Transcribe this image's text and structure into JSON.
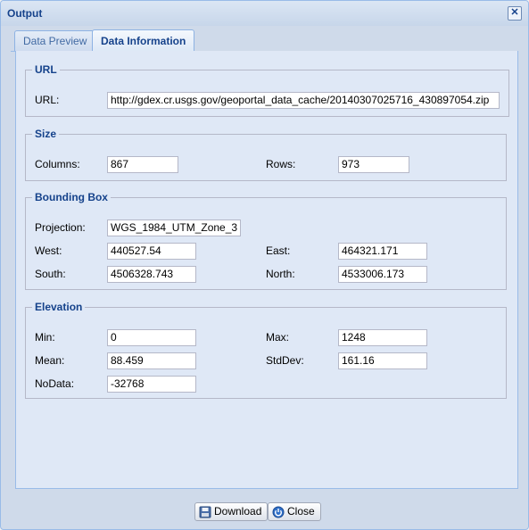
{
  "window": {
    "title": "Output"
  },
  "tabs": [
    {
      "label": "Data Preview"
    },
    {
      "label": "Data Information"
    }
  ],
  "url_section": {
    "legend": "URL",
    "label": "URL:",
    "value": "http://gdex.cr.usgs.gov/geoportal_data_cache/20140307025716_430897054.zip"
  },
  "size_section": {
    "legend": "Size",
    "columns_label": "Columns:",
    "columns": "867",
    "rows_label": "Rows:",
    "rows": "973"
  },
  "bbox_section": {
    "legend": "Bounding Box",
    "projection_label": "Projection:",
    "projection": "WGS_1984_UTM_Zone_3",
    "west_label": "West:",
    "west": "440527.54",
    "east_label": "East:",
    "east": "464321.171",
    "south_label": "South:",
    "south": "4506328.743",
    "north_label": "North:",
    "north": "4533006.173"
  },
  "elevation_section": {
    "legend": "Elevation",
    "min_label": "Min:",
    "min": "0",
    "max_label": "Max:",
    "max": "1248",
    "mean_label": "Mean:",
    "mean": "88.459",
    "stddev_label": "StdDev:",
    "stddev": "161.16",
    "nodata_label": "NoData:",
    "nodata": "-32768"
  },
  "buttons": {
    "download": "Download",
    "close": "Close"
  },
  "icons": {
    "download": "floppy-disk-icon",
    "close": "power-icon",
    "window_close": "close-icon"
  },
  "colors": {
    "title": "#15428b",
    "window_bg": "#cfdaea",
    "panel_bg": "#dfe8f6"
  }
}
